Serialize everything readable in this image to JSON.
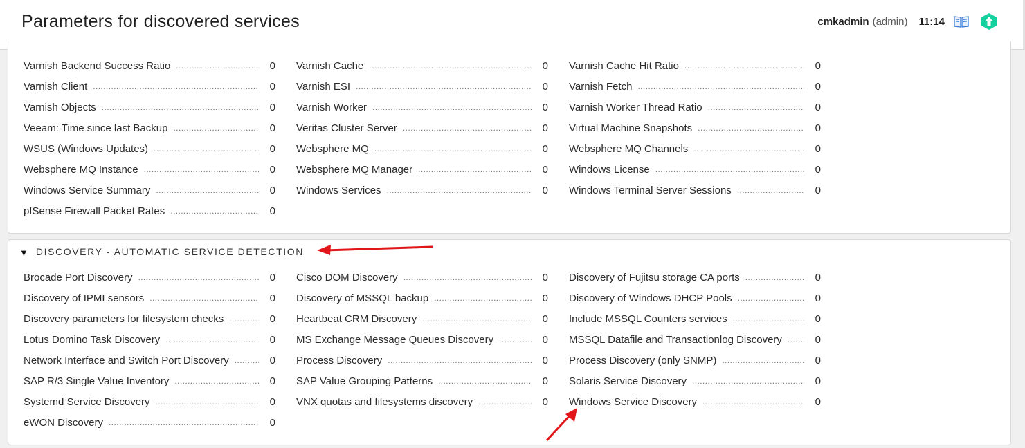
{
  "header": {
    "title": "Parameters for discovered services",
    "user": "cmkadmin",
    "role": "(admin)",
    "time": "11:14",
    "help_icon": "book-icon",
    "logo_icon": "checkmk-logo-icon"
  },
  "top_section": {
    "rows": [
      [
        {
          "label": "Varnish Backend Success Ratio",
          "count": "0"
        },
        {
          "label": "Varnish Cache",
          "count": "0"
        },
        {
          "label": "Varnish Cache Hit Ratio",
          "count": "0"
        }
      ],
      [
        {
          "label": "Varnish Client",
          "count": "0"
        },
        {
          "label": "Varnish ESI",
          "count": "0"
        },
        {
          "label": "Varnish Fetch",
          "count": "0"
        }
      ],
      [
        {
          "label": "Varnish Objects",
          "count": "0"
        },
        {
          "label": "Varnish Worker",
          "count": "0"
        },
        {
          "label": "Varnish Worker Thread Ratio",
          "count": "0"
        }
      ],
      [
        {
          "label": "Veeam: Time since last Backup",
          "count": "0"
        },
        {
          "label": "Veritas Cluster Server",
          "count": "0"
        },
        {
          "label": "Virtual Machine Snapshots",
          "count": "0"
        }
      ],
      [
        {
          "label": "WSUS (Windows Updates)",
          "count": "0"
        },
        {
          "label": "Websphere MQ",
          "count": "0"
        },
        {
          "label": "Websphere MQ Channels",
          "count": "0"
        }
      ],
      [
        {
          "label": "Websphere MQ Instance",
          "count": "0"
        },
        {
          "label": "Websphere MQ Manager",
          "count": "0"
        },
        {
          "label": "Windows License",
          "count": "0"
        }
      ],
      [
        {
          "label": "Windows Service Summary",
          "count": "0"
        },
        {
          "label": "Windows Services",
          "count": "0"
        },
        {
          "label": "Windows Terminal Server Sessions",
          "count": "0"
        }
      ],
      [
        {
          "label": "pfSense Firewall Packet Rates",
          "count": "0"
        }
      ]
    ]
  },
  "discovery_section": {
    "title": "DISCOVERY - AUTOMATIC SERVICE DETECTION",
    "toggle_icon": "triangle-down-icon",
    "rows": [
      [
        {
          "label": "Brocade Port Discovery",
          "count": "0"
        },
        {
          "label": "Cisco DOM Discovery",
          "count": "0"
        },
        {
          "label": "Discovery of Fujitsu storage CA ports",
          "count": "0"
        }
      ],
      [
        {
          "label": "Discovery of IPMI sensors",
          "count": "0"
        },
        {
          "label": "Discovery of MSSQL backup",
          "count": "0"
        },
        {
          "label": "Discovery of Windows DHCP Pools",
          "count": "0"
        }
      ],
      [
        {
          "label": "Discovery parameters for filesystem checks",
          "count": "0"
        },
        {
          "label": "Heartbeat CRM Discovery",
          "count": "0"
        },
        {
          "label": "Include MSSQL Counters services",
          "count": "0"
        }
      ],
      [
        {
          "label": "Lotus Domino Task Discovery",
          "count": "0"
        },
        {
          "label": "MS Exchange Message Queues Discovery",
          "count": "0"
        },
        {
          "label": "MSSQL Datafile and Transactionlog Discovery",
          "count": "0"
        }
      ],
      [
        {
          "label": "Network Interface and Switch Port Discovery",
          "count": "0"
        },
        {
          "label": "Process Discovery",
          "count": "0"
        },
        {
          "label": "Process Discovery (only SNMP)",
          "count": "0"
        }
      ],
      [
        {
          "label": "SAP R/3 Single Value Inventory",
          "count": "0"
        },
        {
          "label": "SAP Value Grouping Patterns",
          "count": "0"
        },
        {
          "label": "Solaris Service Discovery",
          "count": "0"
        }
      ],
      [
        {
          "label": "Systemd Service Discovery",
          "count": "0"
        },
        {
          "label": "VNX quotas and filesystems discovery",
          "count": "0"
        },
        {
          "label": "Windows Service Discovery",
          "count": "0"
        }
      ],
      [
        {
          "label": "eWON Discovery",
          "count": "0"
        }
      ]
    ]
  },
  "colors": {
    "accent_logo": "#15d1a0",
    "annotation_arrow": "#e0161b",
    "help_icon": "#3b7dd8"
  }
}
